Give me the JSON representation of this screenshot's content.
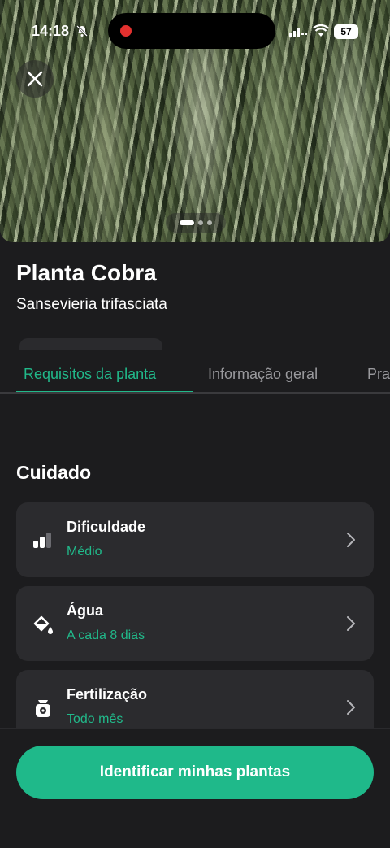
{
  "status_bar": {
    "time": "14:18",
    "battery": "57"
  },
  "plant": {
    "name": "Planta Cobra",
    "scientific_name": "Sansevieria trifasciata"
  },
  "tabs": [
    {
      "label": "Requisitos da planta"
    },
    {
      "label": "Informação geral"
    },
    {
      "label": "Pra"
    }
  ],
  "section": {
    "title": "Cuidado"
  },
  "cards": [
    {
      "label": "Dificuldade",
      "value": "Médio",
      "icon": "difficulty-bars-icon"
    },
    {
      "label": "Água",
      "value": "A cada 8 dias",
      "icon": "water-can-icon"
    },
    {
      "label": "Fertilização",
      "value": "Todo mês",
      "icon": "fertilizer-bag-icon"
    }
  ],
  "cta": {
    "label": "Identificar minhas plantas"
  },
  "colors": {
    "accent": "#21b98a",
    "background": "#1c1c1e",
    "card": "#2b2b2e"
  }
}
